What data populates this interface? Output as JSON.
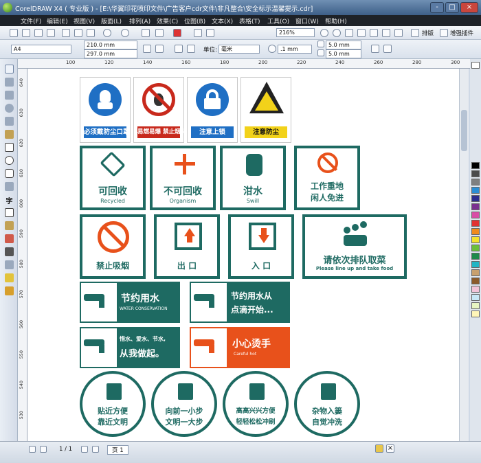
{
  "window": {
    "title": "CorelDRAW X4 ( 专业版 ) - [E:\\华翼印花喷印文件\\广告客户cdr文件\\非凡整合\\安全标示温馨提示.cdr]",
    "buttons": [
      "-",
      "□",
      "×"
    ]
  },
  "menu": [
    "文件(F)",
    "编辑(E)",
    "视图(V)",
    "版面(L)",
    "排列(A)",
    "效果(C)",
    "位图(B)",
    "文本(X)",
    "表格(T)",
    "工具(O)",
    "窗口(W)",
    "帮助(H)"
  ],
  "toolbar1": {
    "zoom": "216%",
    "layout_label": "排版",
    "plugin_label": "增强插件"
  },
  "toolbar2": {
    "paper": "A4",
    "width": "210.0 mm",
    "height": "297.0 mm",
    "units_label": "单位:",
    "units": "毫米",
    "nudge": ".1 mm",
    "dup_x": "5.0 mm",
    "dup_y": "5.0 mm"
  },
  "hruler_ticks": [
    "100",
    "120",
    "140",
    "160",
    "180",
    "200",
    "220",
    "240",
    "260",
    "280",
    "300"
  ],
  "vruler_ticks": [
    "640",
    "630",
    "620",
    "610",
    "600",
    "590",
    "580",
    "570",
    "560",
    "550",
    "540",
    "530"
  ],
  "status": {
    "page_counter": "1 / 1",
    "page_tab": "页 1"
  },
  "signs": {
    "row1": [
      {
        "caption": "必须戴防尘口罩",
        "color": "#1f6fc4"
      },
      {
        "caption": "易燃易爆 禁止烟火",
        "color": "#c8291c"
      },
      {
        "caption": "注意上锁",
        "color": "#1f6fc4"
      },
      {
        "caption": "注意防尘",
        "color": "#f2d21a"
      }
    ],
    "row2": [
      {
        "zh": "可回收",
        "en": "Recycled"
      },
      {
        "zh": "不可回收",
        "en": "Organism"
      },
      {
        "zh": "泔水",
        "en": "Swill"
      },
      {
        "zh1": "工作重地",
        "zh2": "闲人免进"
      }
    ],
    "row3": [
      {
        "zh": "禁止吸烟"
      },
      {
        "zh": "出 口"
      },
      {
        "zh": "入 口"
      },
      {
        "zh": "请依次排队取菜",
        "en": "Please line up and take food"
      }
    ],
    "water": [
      {
        "zh": "节约用水",
        "en": "WATER CONSERVATION"
      },
      {
        "zh1": "节约用水从",
        "zh2": "点滴开始..."
      },
      {
        "zh1": "惜水、爱水、节水,",
        "zh2": "从我做起。"
      },
      {
        "zh": "小心烫手",
        "en": "Careful hot"
      }
    ],
    "toilet": [
      {
        "l1": "贴近方便",
        "l2": "靠近文明"
      },
      {
        "l1": "向前一小步",
        "l2": "文明一大步"
      },
      {
        "l1": "高高兴兴方便",
        "l2": "轻轻松松冲刷"
      },
      {
        "l1": "杂物入篓",
        "l2": "自觉冲洗"
      }
    ]
  },
  "colors": {
    "teal": "#1e6a62",
    "orange": "#e8511b",
    "red": "#c8291c",
    "blue": "#1f6fc4",
    "yellow": "#f2d21a"
  }
}
